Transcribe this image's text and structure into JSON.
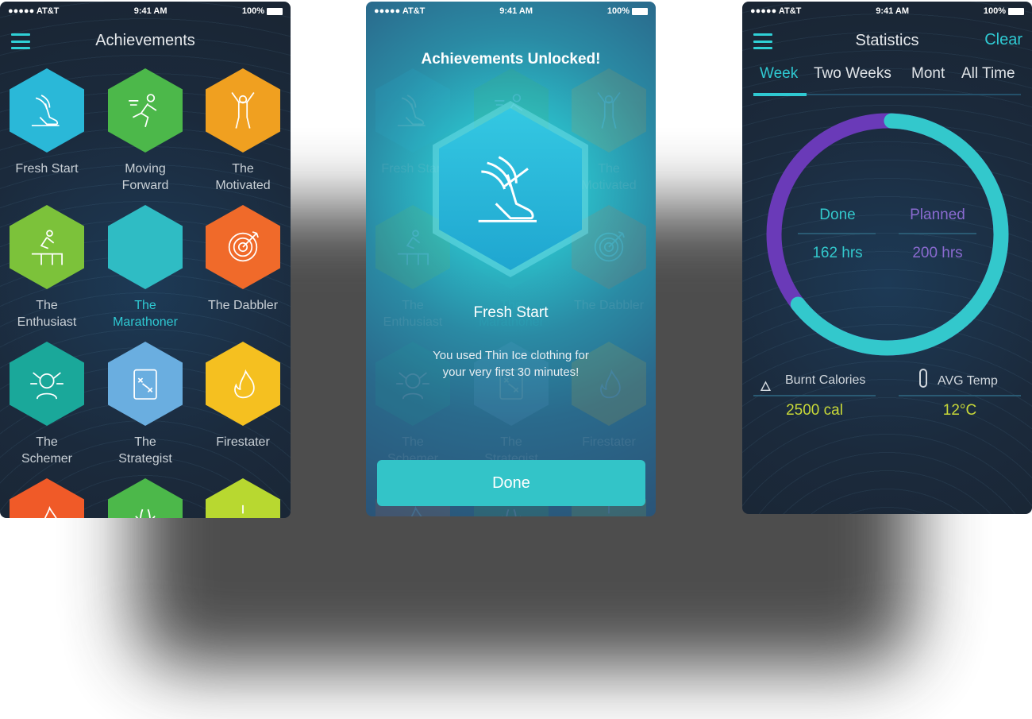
{
  "status_bar": {
    "carrier": "●●●●● AT&T",
    "time": "9:41 AM",
    "battery": "100%"
  },
  "achievements": {
    "title": "Achievements",
    "items": [
      {
        "label": "Fresh Start",
        "color": "#2ab8d8",
        "icon": "winged-foot-icon"
      },
      {
        "label": "Moving Forward",
        "color": "#4cb84a",
        "icon": "runner-icon"
      },
      {
        "label": "The Motivated",
        "color": "#f0a020",
        "icon": "cheering-person-icon"
      },
      {
        "label": "The Enthusiast",
        "color": "#7cc23a",
        "icon": "hurdle-jumper-icon"
      },
      {
        "label": "The Marathoner",
        "color": "#2fbcc4",
        "icon": "locked-icon",
        "highlighted": true
      },
      {
        "label": "The Dabbler",
        "color": "#f06a2a",
        "icon": "target-icon"
      },
      {
        "label": "The Schemer",
        "color": "#1aa89a",
        "icon": "network-person-icon"
      },
      {
        "label": "The Strategist",
        "color": "#6aaee0",
        "icon": "clipboard-icon"
      },
      {
        "label": "Firestater",
        "color": "#f5c020",
        "icon": "match-fire-icon"
      },
      {
        "label": "",
        "color": "#f05a28",
        "icon": "flame-icon"
      },
      {
        "label": "",
        "color": "#4cb84a",
        "icon": "arrows-icon"
      },
      {
        "label": "",
        "color": "#b8d830",
        "icon": "sparkle-icon"
      }
    ]
  },
  "unlock": {
    "title": "Achievements Unlocked!",
    "badge_name": "Fresh Start",
    "description_line1": "You used Thin Ice clothing for",
    "description_line2": "your very first 30 minutes!",
    "done_label": "Done"
  },
  "statistics": {
    "title": "Statistics",
    "clear_label": "Clear",
    "tabs": [
      "Week",
      "Two Weeks",
      "Mont",
      "All Time"
    ],
    "active_tab": "Week",
    "done_label": "Done",
    "done_value": "162 hrs",
    "planned_label": "Planned",
    "planned_value": "200 hrs",
    "done_color": "#33c8cc",
    "planned_color": "#6a3ab8",
    "burnt_calories_label": "Burnt Calories",
    "burnt_calories_value": "2500 cal",
    "avg_temp_label": "AVG Temp",
    "avg_temp_value": "12°C",
    "value_color": "#c8d838"
  }
}
